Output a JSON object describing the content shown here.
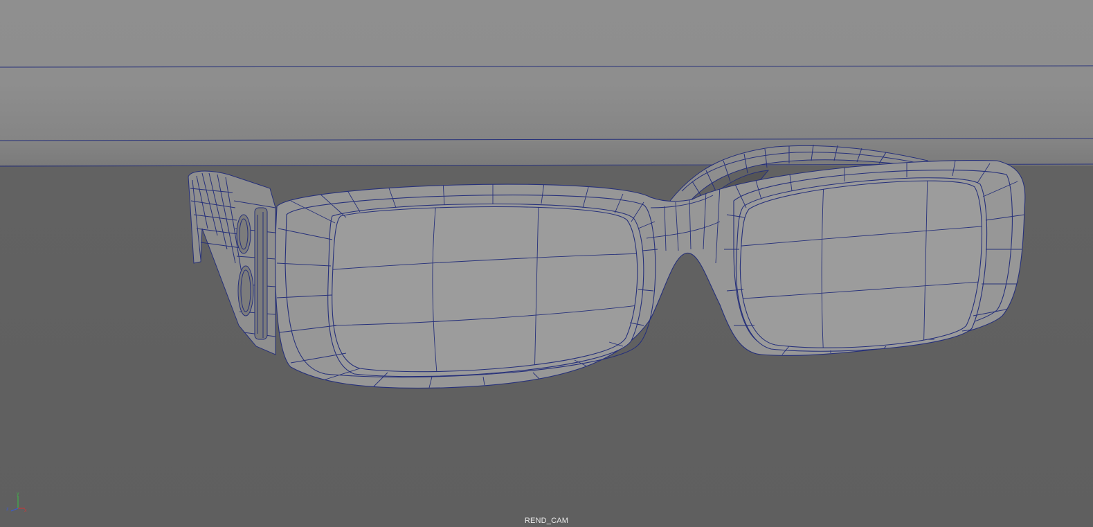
{
  "viewport": {
    "camera_name": "REND_CAM",
    "colors": {
      "background_top": "#8f8f8f",
      "floor": "#5f5f5f",
      "wire": "#1d2a7a",
      "surface": "#9a9a9a"
    }
  },
  "axis_gizmo": {
    "x_label": "x",
    "y_label": "y",
    "z_label": "z",
    "colors": {
      "x": "#c23b3b",
      "y": "#3fb24a",
      "z": "#3a5ad6"
    }
  }
}
